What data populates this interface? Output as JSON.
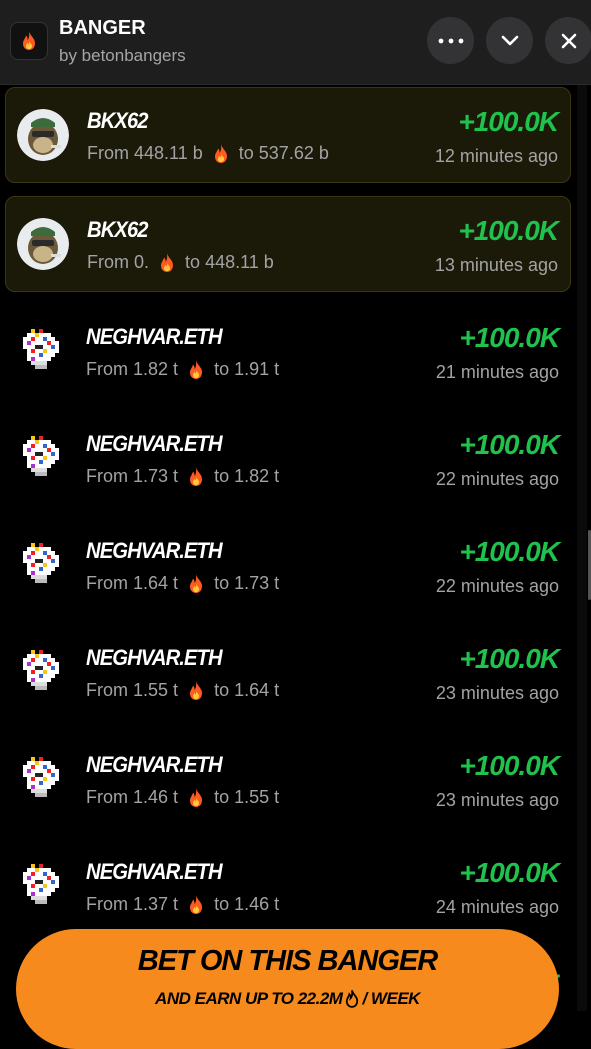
{
  "header": {
    "title": "BANGER",
    "subtitle": "by betonbangers",
    "app_icon": "fire-icon",
    "buttons": [
      "more-icon",
      "chevron-down-icon",
      "close-icon"
    ]
  },
  "rows": [
    {
      "name": "BKX62",
      "from_label": "From",
      "from": "448.11 b",
      "to_label": "to",
      "to": "537.62 b",
      "amount": "+100.0K",
      "time": "12 minutes ago",
      "highlighted": true,
      "avatar": "ape-avatar"
    },
    {
      "name": "BKX62",
      "from_label": "From",
      "from": "0.",
      "to_label": "to",
      "to": "448.11 b",
      "amount": "+100.0K",
      "time": "13 minutes ago",
      "highlighted": true,
      "avatar": "ape-avatar"
    },
    {
      "name": "NEGHVAR.ETH",
      "from_label": "From",
      "from": "1.82 t",
      "to_label": "to",
      "to": "1.91 t",
      "amount": "+100.0K",
      "time": "21 minutes ago",
      "highlighted": false,
      "avatar": "pixel-unicorn-avatar"
    },
    {
      "name": "NEGHVAR.ETH",
      "from_label": "From",
      "from": "1.73 t",
      "to_label": "to",
      "to": "1.82 t",
      "amount": "+100.0K",
      "time": "22 minutes ago",
      "highlighted": false,
      "avatar": "pixel-unicorn-avatar"
    },
    {
      "name": "NEGHVAR.ETH",
      "from_label": "From",
      "from": "1.64 t",
      "to_label": "to",
      "to": "1.73 t",
      "amount": "+100.0K",
      "time": "22 minutes ago",
      "highlighted": false,
      "avatar": "pixel-unicorn-avatar"
    },
    {
      "name": "NEGHVAR.ETH",
      "from_label": "From",
      "from": "1.55 t",
      "to_label": "to",
      "to": "1.64 t",
      "amount": "+100.0K",
      "time": "23 minutes ago",
      "highlighted": false,
      "avatar": "pixel-unicorn-avatar"
    },
    {
      "name": "NEGHVAR.ETH",
      "from_label": "From",
      "from": "1.46 t",
      "to_label": "to",
      "to": "1.55 t",
      "amount": "+100.0K",
      "time": "23 minutes ago",
      "highlighted": false,
      "avatar": "pixel-unicorn-avatar"
    },
    {
      "name": "NEGHVAR.ETH",
      "from_label": "From",
      "from": "1.37 t",
      "to_label": "to",
      "to": "1.46 t",
      "amount": "+100.0K",
      "time": "24 minutes ago",
      "highlighted": false,
      "avatar": "pixel-unicorn-avatar"
    }
  ],
  "cta": {
    "main": "BET ON THIS BANGER",
    "sub_prefix": "AND EARN UP TO 22.2M",
    "sub_suffix": "/ WEEK",
    "icon": "fire-icon"
  },
  "colors": {
    "accent_green": "#1fc24d",
    "cta_orange": "#f78a1c",
    "highlight_bg": "#1b1907",
    "header_bg": "#1e1e1f"
  }
}
